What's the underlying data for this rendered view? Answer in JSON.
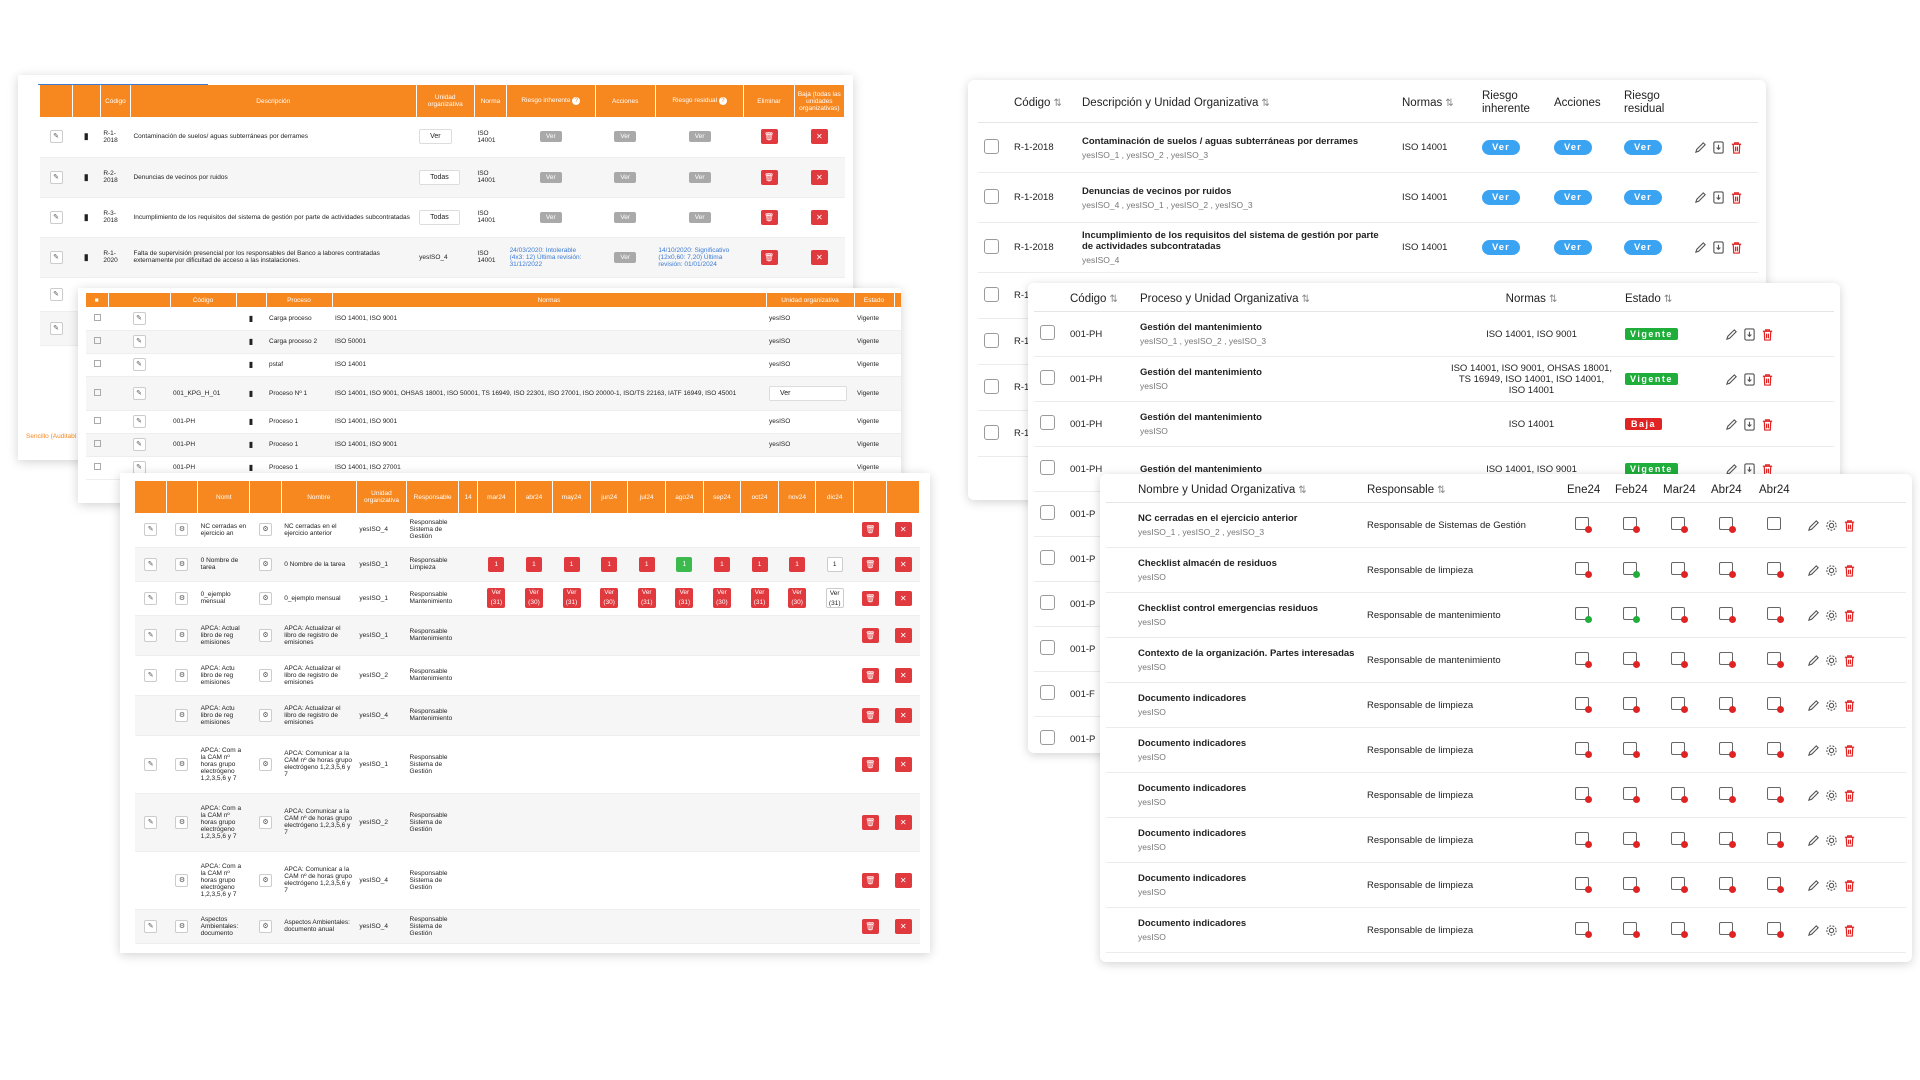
{
  "old_risks": {
    "headers": [
      "",
      "",
      "Código",
      "Descripción",
      "Unidad organizativa",
      "Norma",
      "Riesgo inherente",
      "Acciones",
      "Riesgo residual",
      "Eliminar",
      "Baja (todas las unidades organizativas)"
    ],
    "rows": [
      {
        "code": "R-1-2018",
        "desc": "Contaminación de suelos/ aguas subterráneas por derrames",
        "unit": "Ver",
        "norm": "ISO 14001",
        "inh": "Ver",
        "acc": "Ver",
        "res": "Ver"
      },
      {
        "code": "R-2-2018",
        "desc": "Denuncias de vecinos por ruidos",
        "unit": "Todas",
        "norm": "ISO 14001",
        "inh": "Ver",
        "acc": "Ver",
        "res": "Ver"
      },
      {
        "code": "R-3-2018",
        "desc": "Incumplimiento de los requisitos del sistema de gestión por parte de actividades subcontratadas",
        "unit": "Todas",
        "norm": "ISO 14001",
        "inh": "Ver",
        "acc": "Ver",
        "res": "Ver"
      },
      {
        "code": "R-1-2020",
        "desc": "Falta de supervisión presencial por los responsables del Banco a labores contratadas externamente por dificultad de acceso a las instalaciones.",
        "unit": "yesISO_4",
        "norm": "ISO 14001",
        "inh": "24/03/2020: Intolerable (4x3: 12) Última revisión: 31/12/2022",
        "acc": "Ver",
        "res": "14/10/2020: Significativo (12x0,60: 7,20) Última revisión: 01/01/2024"
      }
    ],
    "footer": "Sencillo (Auditabl"
  },
  "old_process": {
    "headers": [
      "■",
      "",
      "Código",
      "",
      "Proceso",
      "Normas",
      "Unidad organizativa",
      "Estado",
      ""
    ],
    "rows": [
      {
        "code": "",
        "proc": "Carga proceso",
        "norms": "ISO 14001, ISO 9001",
        "unit": "yesISO",
        "state": "Vigente"
      },
      {
        "code": "",
        "proc": "Carga proceso 2",
        "norms": "ISO 50001",
        "unit": "yesISO",
        "state": "Vigente"
      },
      {
        "code": "",
        "proc": "pstaf",
        "norms": "ISO 14001",
        "unit": "yesISO",
        "state": "Vigente"
      },
      {
        "code": "001_KPG_H_01",
        "proc": "Proceso Nº 1",
        "norms": "ISO 14001, ISO 9001, OHSAS 18001, ISO 50001, TS 16949, ISO 22301, ISO 27001, ISO 20000-1, ISO/TS 22163, IATF 16949, ISO 45001",
        "unit": "Ver",
        "state": "Vigente"
      },
      {
        "code": "001-PH",
        "proc": "Proceso 1",
        "norms": "ISO 14001, ISO 9001",
        "unit": "yesISO",
        "state": "Vigente"
      },
      {
        "code": "001-PH",
        "proc": "Proceso 1",
        "norms": "ISO 14001, ISO 9001",
        "unit": "yesISO",
        "state": "Vigente"
      },
      {
        "code": "001-PH",
        "proc": "Proceso 1",
        "norms": "ISO 14001, ISO 27001",
        "unit": "",
        "state": "Vigente"
      }
    ]
  },
  "old_tasks": {
    "headers": [
      "",
      "",
      "Nomt",
      "",
      "Nombre",
      "Unidad organizativa",
      "Responsable",
      "14",
      "mar24",
      "abr24",
      "may24",
      "jun24",
      "jul24",
      "ago24",
      "sep24",
      "oct24",
      "nov24",
      "dic24",
      "",
      ""
    ],
    "rows": [
      {
        "n1": "NC cerradas en ejercicio an",
        "n2": "NC cerradas en el ejercicio anterior",
        "unit": "yesISO_4",
        "resp": "Responsable Sistema de Gestión",
        "cells": []
      },
      {
        "n1": "0 Nombre de tarea",
        "n2": "0 Nombre de la tarea",
        "unit": "yesISO_1",
        "resp": "Responsable Limpieza",
        "cells": [
          "1",
          "1",
          "1",
          "1",
          "1",
          "1",
          "1",
          "1",
          "1",
          "1"
        ]
      },
      {
        "n1": "0_ejemplo mensual",
        "n2": "0_ejemplo mensual",
        "unit": "yesISO_1",
        "resp": "Responsable Mantenimiento",
        "cells": [
          "Ver (31)",
          "Ver (30)",
          "Ver (31)",
          "Ver (30)",
          "Ver (31)",
          "Ver (31)",
          "Ver (30)",
          "Ver (31)",
          "Ver (30)",
          "Ver (31)"
        ]
      },
      {
        "n1": "APCA: Actual libro de reg emisiones",
        "n2": "APCA: Actualizar el libro de registro de emisiones",
        "unit": "yesISO_1",
        "resp": "Responsable Mantenimiento",
        "cells": []
      },
      {
        "n1": "APCA: Actu libro de reg emisiones",
        "n2": "APCA: Actualizar el libro de registro de emisiones",
        "unit": "yesISO_2",
        "resp": "Responsable Mantenimiento",
        "cells": []
      },
      {
        "n1": "APCA: Actu libro de reg emisiones",
        "n2": "APCA: Actualizar el libro de registro de emisiones",
        "unit": "yesISO_4",
        "resp": "Responsable Mantenimiento",
        "cells": []
      },
      {
        "n1": "APCA: Com a la CAM nº horas grupo electrógeno 1,2,3,5,6 y 7",
        "n2": "APCA: Comunicar a la CAM nº de horas grupo electrógeno 1,2,3,5,6 y 7",
        "unit": "yesISO_1",
        "resp": "Responsable Sistema de Gestión",
        "cells": []
      },
      {
        "n1": "APCA: Com a la CAM nº horas grupo electrógeno 1,2,3,5,6 y 7",
        "n2": "APCA: Comunicar a la CAM nº de horas grupo electrógeno 1,2,3,5,6 y 7",
        "unit": "yesISO_2",
        "resp": "Responsable Sistema de Gestión",
        "cells": []
      },
      {
        "n1": "APCA: Com a la CAM nº horas grupo electrógeno 1,2,3,5,6 y 7",
        "n2": "APCA: Comunicar a la CAM nº de horas grupo electrógeno 1,2,3,5,6 y 7",
        "unit": "yesISO_4",
        "resp": "Responsable Sistema de Gestión",
        "cells": []
      },
      {
        "n1": "Aspectos Ambientales: documento",
        "n2": "Aspectos Ambientales: documento anual",
        "unit": "yesISO_4",
        "resp": "Responsable Sistema de Gestión",
        "cells": []
      }
    ]
  },
  "new_risks": {
    "headers": {
      "code": "Código",
      "desc": "Descripción y Unidad Organizativa",
      "norms": "Normas",
      "inh": "Riesgo inherente",
      "acc": "Acciones",
      "res": "Riesgo residual"
    },
    "pill": "Ver",
    "rows": [
      {
        "code": "R-1-2018",
        "title": "Contaminación de suelos / aguas subterráneas por derrames",
        "units": "yesISO_1 , yesISO_2 , yesISO_3",
        "norm": "ISO 14001"
      },
      {
        "code": "R-1-2018",
        "title": "Denuncias de vecinos por ruidos",
        "units": "yesISO_4 , yesISO_1 , yesISO_2 , yesISO_3",
        "norm": "ISO 14001"
      },
      {
        "code": "R-1-2018",
        "title": "Incumplimiento de los requisitos del sistema de gestión por parte de actividades subcontratadas",
        "units": "yesISO_4",
        "norm": "ISO 14001"
      },
      {
        "code": "R-1-"
      },
      {
        "code": "R-1-"
      },
      {
        "code": "R-1-"
      },
      {
        "code": "R-1-"
      }
    ]
  },
  "new_process": {
    "headers": {
      "code": "Código",
      "proc": "Proceso y Unidad Organizativa",
      "norms": "Normas",
      "state": "Estado"
    },
    "rows": [
      {
        "code": "001-PH",
        "title": "Gestión del mantenimiento",
        "units": "yesISO_1 , yesISO_2 , yesISO_3",
        "norms": "ISO 14001, ISO 9001",
        "state": "Vigente"
      },
      {
        "code": "001-PH",
        "title": "Gestión del mantenimiento",
        "units": "yesISO",
        "norms": "ISO 14001, ISO 9001, OHSAS 18001, TS 16949, ISO 14001, ISO 14001, ISO 14001",
        "state": "Vigente"
      },
      {
        "code": "001-PH",
        "title": "Gestión del mantenimiento",
        "units": "yesISO",
        "norms": "ISO 14001",
        "state": "Baja"
      },
      {
        "code": "001-PH",
        "title": "Gestión del mantenimiento",
        "units": "",
        "norms": "ISO 14001, ISO 9001",
        "state": "Vigente"
      },
      {
        "code": "001-P"
      },
      {
        "code": "001-P"
      },
      {
        "code": "001-P"
      },
      {
        "code": "001-P"
      },
      {
        "code": "001-F"
      },
      {
        "code": "001-P"
      }
    ]
  },
  "new_tasks": {
    "headers": {
      "name": "Nombre y Unidad Organizativa",
      "resp": "Responsable",
      "months": [
        "Ene24",
        "Feb24",
        "Mar24",
        "Abr24",
        "Abr24"
      ]
    },
    "rows": [
      {
        "title": "NC cerradas en el ejercicio anterior",
        "units": "yesISO_1 , yesISO_2 , yesISO_3",
        "resp": "Responsable de Sistemas de Gestión",
        "dots": [
          "red",
          "red",
          "red",
          "red",
          "none"
        ]
      },
      {
        "title": "Checklist almacén de residuos",
        "units": "yesISO",
        "resp": "Responsable de limpieza",
        "dots": [
          "red",
          "green",
          "red",
          "red",
          "red"
        ]
      },
      {
        "title": "Checklist control emergencias residuos",
        "units": "yesISO",
        "resp": "Responsable de mantenimiento",
        "dots": [
          "green",
          "green",
          "red",
          "red",
          "red"
        ]
      },
      {
        "title": "Contexto de la organización. Partes interesadas",
        "units": "yesISO",
        "resp": "Responsable de mantenimiento",
        "dots": [
          "red",
          "red",
          "red",
          "red",
          "red"
        ]
      },
      {
        "title": "Documento indicadores",
        "units": "yesISO",
        "resp": "Responsable de limpieza",
        "dots": [
          "red",
          "red",
          "red",
          "red",
          "red"
        ]
      },
      {
        "title": "Documento indicadores",
        "units": "yesISO",
        "resp": "Responsable de limpieza",
        "dots": [
          "red",
          "red",
          "red",
          "red",
          "red"
        ]
      },
      {
        "title": "Documento indicadores",
        "units": "yesISO",
        "resp": "Responsable de limpieza",
        "dots": [
          "red",
          "red",
          "red",
          "red",
          "red"
        ]
      },
      {
        "title": "Documento indicadores",
        "units": "yesISO",
        "resp": "Responsable de limpieza",
        "dots": [
          "red",
          "red",
          "red",
          "red",
          "red"
        ]
      },
      {
        "title": "Documento indicadores",
        "units": "yesISO",
        "resp": "Responsable de limpieza",
        "dots": [
          "red",
          "red",
          "red",
          "red",
          "red"
        ]
      },
      {
        "title": "Documento indicadores",
        "units": "yesISO",
        "resp": "Responsable de limpieza",
        "dots": [
          "red",
          "red",
          "red",
          "red",
          "red"
        ]
      }
    ]
  },
  "colors": {
    "orange": "#f7871f",
    "red": "#e02424",
    "green": "#1fae3a",
    "blue_pill": "#3aa3f2"
  }
}
